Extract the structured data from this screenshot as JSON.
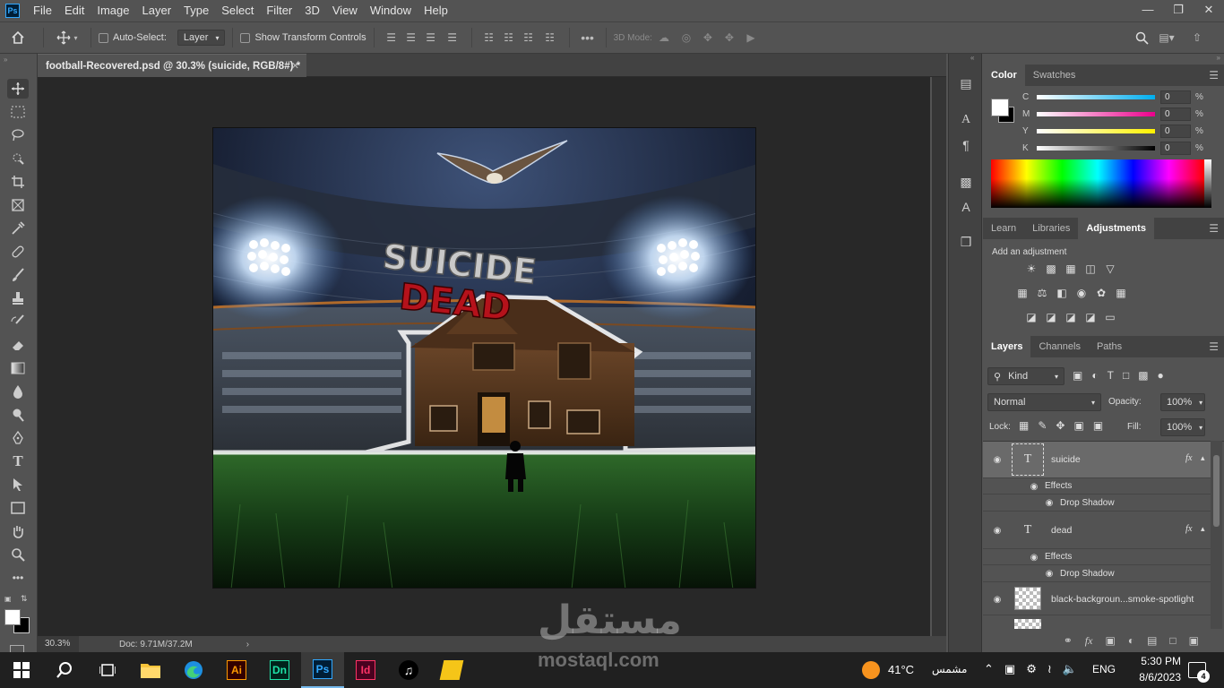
{
  "menu": [
    "File",
    "Edit",
    "Image",
    "Layer",
    "Type",
    "Select",
    "Filter",
    "3D",
    "View",
    "Window",
    "Help"
  ],
  "app_logo": "Ps",
  "options": {
    "auto_select_label": "Auto-Select:",
    "auto_select_target": "Layer",
    "transform_controls_label": "Show Transform Controls",
    "mode_3d_label": "3D Mode:"
  },
  "document": {
    "tab_title": "football-Recovered.psd @ 30.3% (suicide, RGB/8#) *",
    "zoom": "30.3%",
    "doc_size": "Doc: 9.71M/37.2M",
    "artwork_text_top": "SUICIDE",
    "artwork_text_bottom": "DEAD"
  },
  "color_panel": {
    "tabs": [
      "Color",
      "Swatches"
    ],
    "active_tab": "Color",
    "channels": [
      {
        "label": "C",
        "value": "0",
        "colors": [
          "#ffffff",
          "#00aeef"
        ]
      },
      {
        "label": "M",
        "value": "0",
        "colors": [
          "#ffffff",
          "#ec008c"
        ]
      },
      {
        "label": "Y",
        "value": "0",
        "colors": [
          "#ffffff",
          "#fff200"
        ]
      },
      {
        "label": "K",
        "value": "0",
        "colors": [
          "#ffffff",
          "#000000"
        ]
      }
    ],
    "pct": "%"
  },
  "adjustments_panel": {
    "tabs": [
      "Learn",
      "Libraries",
      "Adjustments"
    ],
    "active_tab": "Adjustments",
    "hint": "Add an adjustment"
  },
  "layers_panel": {
    "tabs": [
      "Layers",
      "Channels",
      "Paths"
    ],
    "active_tab": "Layers",
    "filter_kind": "Kind",
    "blend_mode": "Normal",
    "opacity_label": "Opacity:",
    "opacity_value": "100%",
    "lock_label": "Lock:",
    "fill_label": "Fill:",
    "fill_value": "100%",
    "layers": [
      {
        "name": "suicide",
        "type": "text",
        "selected": true,
        "fx": "fx",
        "effects_label": "Effects",
        "effect": "Drop Shadow"
      },
      {
        "name": "dead",
        "type": "text",
        "selected": false,
        "fx": "fx",
        "effects_label": "Effects",
        "effect": "Drop Shadow"
      },
      {
        "name": "black-backgroun...smoke-spotlight",
        "type": "smart",
        "selected": false
      }
    ]
  },
  "taskbar": {
    "weather_temp": "41°C",
    "weather_label": "مشمس",
    "language": "ENG",
    "time": "5:30 PM",
    "date": "8/6/2023",
    "notifications": "4",
    "apps": [
      "File Explorer",
      "Edge",
      "Illustrator",
      "Dimension",
      "Photoshop",
      "InDesign",
      "TikTok",
      "App"
    ],
    "app_labels": {
      "illustrator": "Ai",
      "dimension": "Dn",
      "photoshop": "Ps",
      "indesign": "Id"
    }
  },
  "watermark": {
    "arabic": "مستقل",
    "latin": "mostaql.com"
  },
  "colors": {
    "bg": "#535353",
    "canvas_bg": "#282828",
    "ps_blue": "#31a8ff",
    "ai_orange": "#ff9a00",
    "dn_green": "#1ee3a8",
    "id_pink": "#ff3366"
  }
}
